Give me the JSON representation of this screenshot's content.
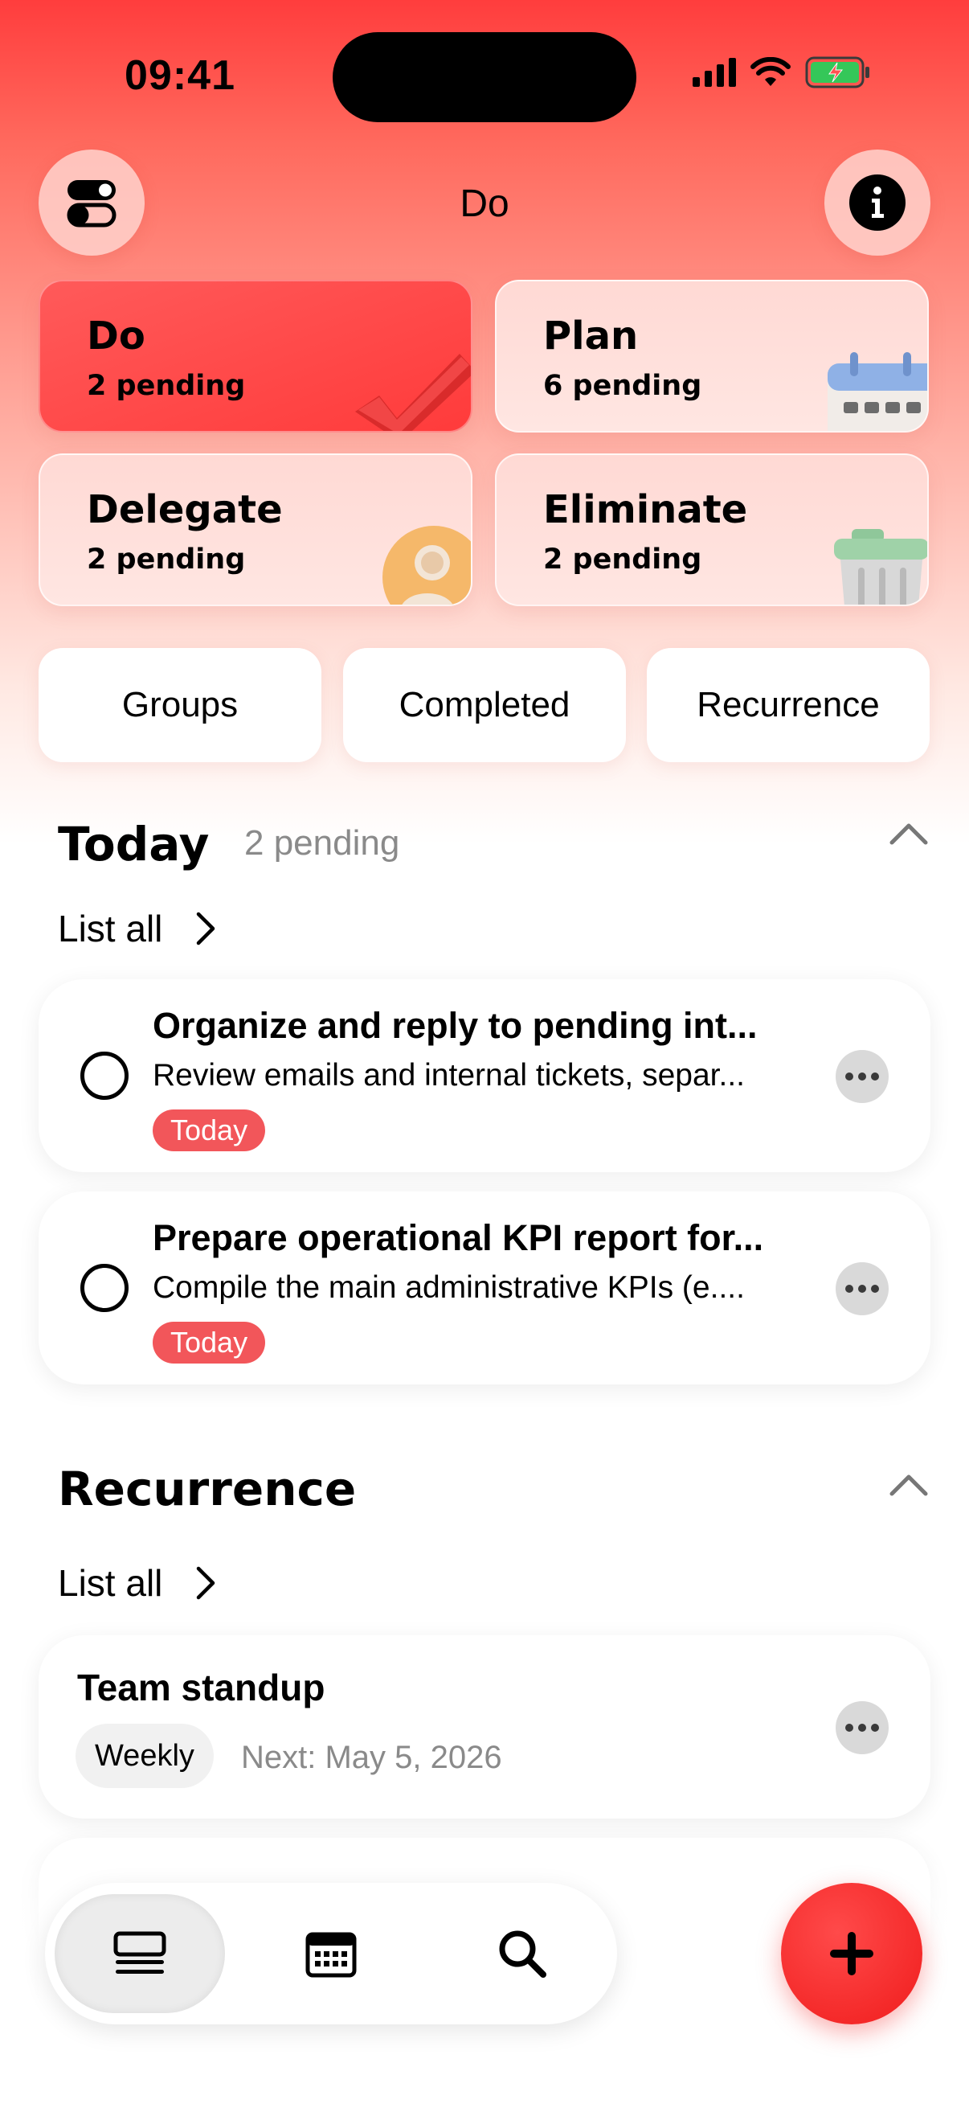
{
  "status": {
    "time": "09:41"
  },
  "header": {
    "title": "Do",
    "left_icon": "toggles-icon",
    "right_icon": "info-icon"
  },
  "quadrants": [
    {
      "title": "Do",
      "sub": "2 pending",
      "icon": "checkmark-icon",
      "active": true
    },
    {
      "title": "Plan",
      "sub": "6 pending",
      "icon": "calendar-icon",
      "active": false
    },
    {
      "title": "Delegate",
      "sub": "2 pending",
      "icon": "person-icon",
      "active": false
    },
    {
      "title": "Eliminate",
      "sub": "2 pending",
      "icon": "trash-icon",
      "active": false
    }
  ],
  "segments": [
    "Groups",
    "Completed",
    "Recurrence"
  ],
  "today": {
    "title": "Today",
    "count": "2 pending",
    "list_all": "List all",
    "tasks": [
      {
        "title": "Organize and reply to pending int...",
        "desc": "Review emails and internal tickets, separ...",
        "tag": "Today"
      },
      {
        "title": "Prepare operational KPI report for...",
        "desc": "Compile the main administrative KPIs (e....",
        "tag": "Today"
      }
    ]
  },
  "recurrence": {
    "title": "Recurrence",
    "list_all": "List all",
    "items": [
      {
        "title": "Team standup",
        "freq": "Weekly",
        "next": "Next: May 5, 2026"
      }
    ]
  },
  "nav": {
    "tabs": [
      "list-icon",
      "calendar-icon",
      "search-icon"
    ],
    "fab": "plus-icon"
  },
  "colors": {
    "accent": "#ff3b3b",
    "tag": "#f2565a"
  }
}
